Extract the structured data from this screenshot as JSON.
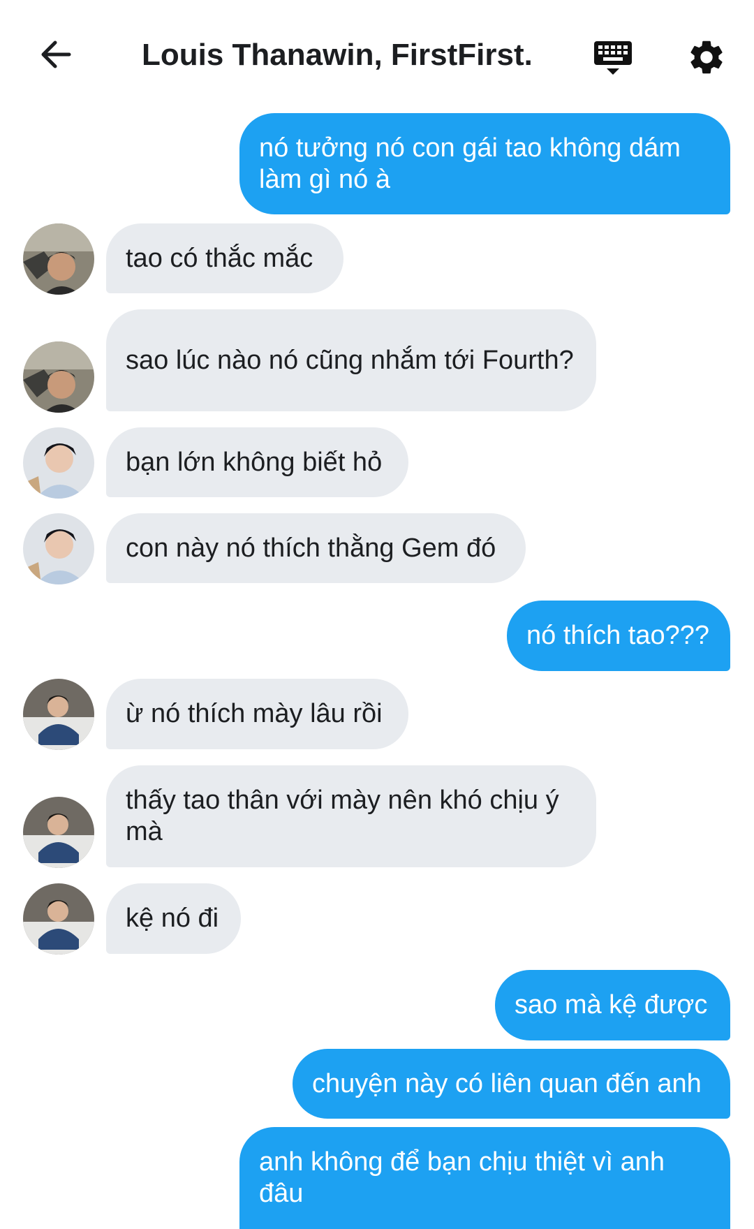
{
  "header": {
    "title": "Louis Thanawin, FirstFirst...",
    "back_icon": "arrow-left-icon",
    "keyboard_icon": "keyboard-icon",
    "settings_icon": "gear-icon"
  },
  "colors": {
    "outgoing_bubble": "#1da1f2",
    "incoming_bubble": "#e8ebef",
    "text_dark": "#1c1e21"
  },
  "messages": [
    {
      "direction": "out",
      "text": "nó tưởng nó con gái tao không dám làm gì nó à"
    },
    {
      "direction": "in",
      "avatar": "avatar-1",
      "text": "tao có thắc mắc"
    },
    {
      "direction": "in",
      "avatar": "avatar-1",
      "text": "sao lúc nào nó cũng nhắm tới Fourth?"
    },
    {
      "direction": "in",
      "avatar": "avatar-2",
      "text": "bạn lớn không biết hỏ"
    },
    {
      "direction": "in",
      "avatar": "avatar-2",
      "text": "con này nó thích thằng Gem đó"
    },
    {
      "direction": "out",
      "text": "nó thích tao???"
    },
    {
      "direction": "in",
      "avatar": "avatar-3",
      "text": "ừ nó thích mày lâu rồi"
    },
    {
      "direction": "in",
      "avatar": "avatar-3",
      "text": "thấy tao thân với mày nên khó chịu ý mà"
    },
    {
      "direction": "in",
      "avatar": "avatar-3",
      "text": "kệ nó đi"
    },
    {
      "direction": "out",
      "text": "sao mà kệ được"
    },
    {
      "direction": "out",
      "text": "chuyện này có liên quan đến anh"
    },
    {
      "direction": "out",
      "text": "anh không để bạn chịu thiệt vì anh đâu"
    }
  ]
}
